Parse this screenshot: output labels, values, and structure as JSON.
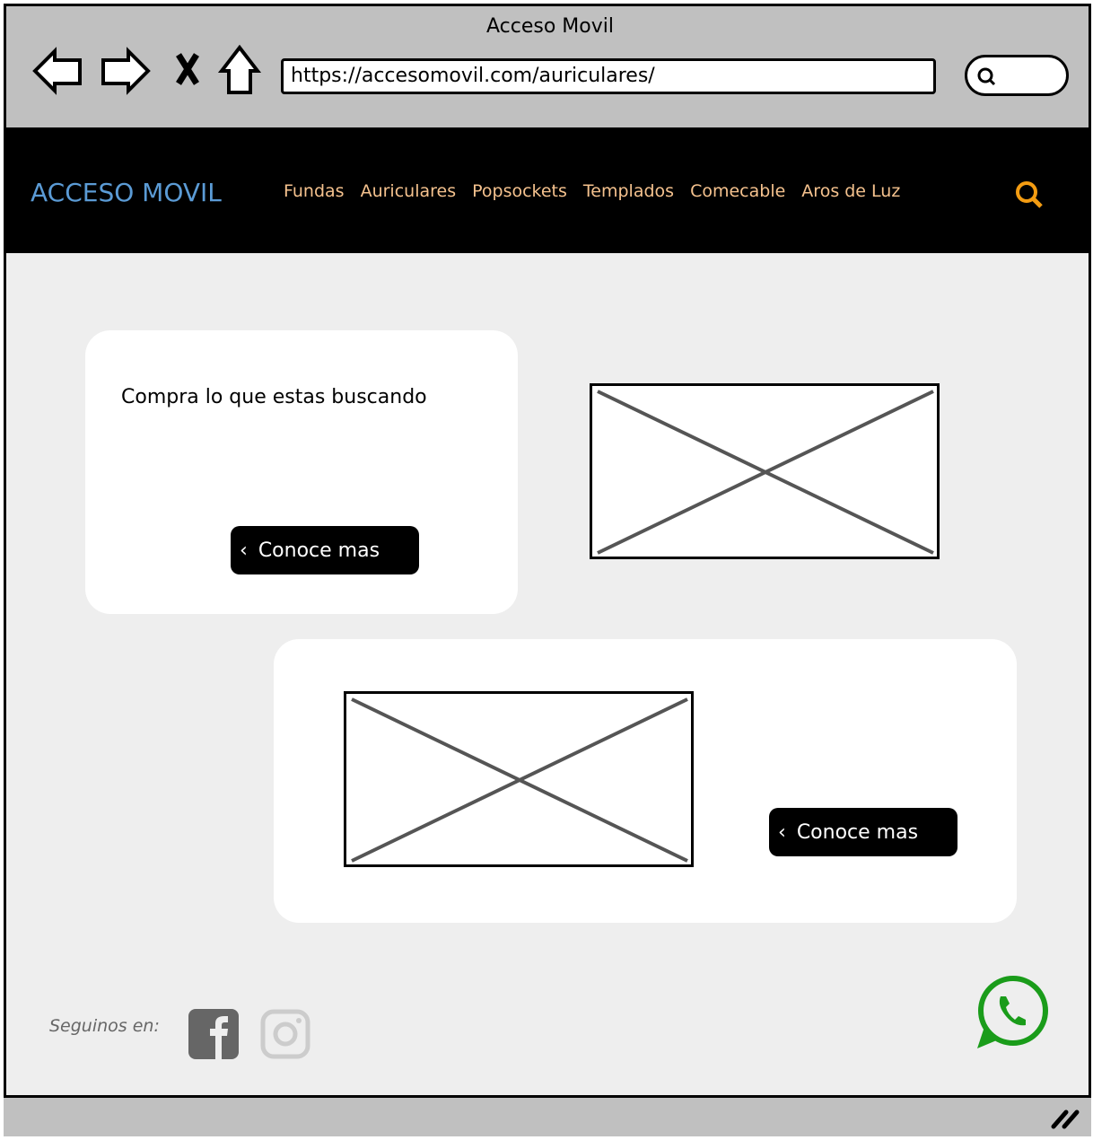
{
  "browser": {
    "title": "Acceso Movil",
    "url": "https://accesomovil.com/auriculares/"
  },
  "nav": {
    "logo": "ACCESO MOVIL",
    "items": [
      "Fundas",
      "Auriculares",
      "Popsockets",
      "Templados",
      "Comecable",
      "Aros de Luz"
    ],
    "logo_color": "#5b9bd5",
    "item_color": "#f5c28e",
    "search_color": "#f39c12"
  },
  "hero": {
    "heading": "Compra lo que estas buscando",
    "button": "Conoce mas"
  },
  "promo": {
    "button": "Conoce mas"
  },
  "footer": {
    "follow_label": "Seguinos en:",
    "social": [
      "facebook-icon",
      "instagram-icon"
    ],
    "whatsapp_color": "#1a9c1a"
  }
}
